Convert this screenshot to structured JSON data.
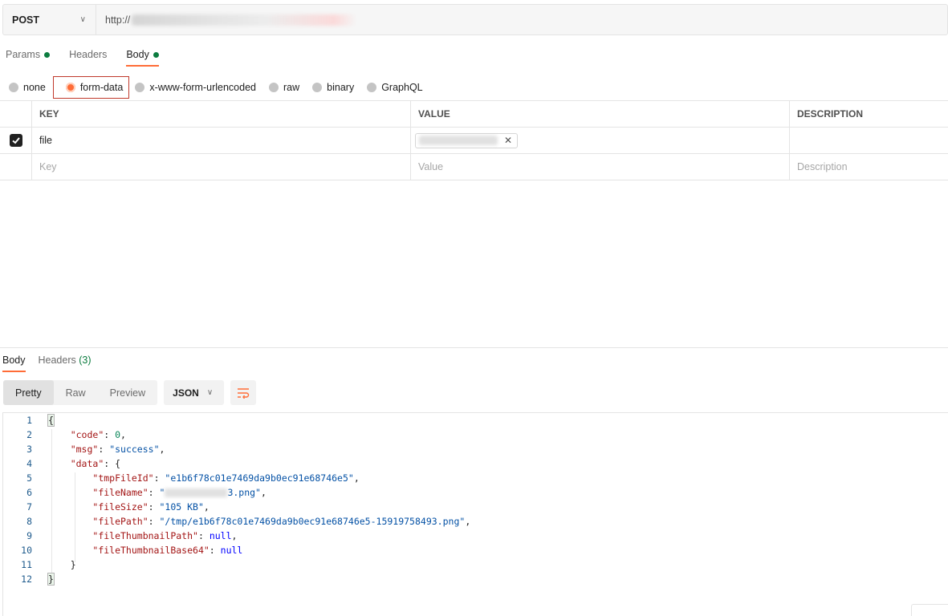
{
  "request": {
    "method": "POST",
    "url_visible": "http://",
    "tabs": [
      {
        "label": "Params",
        "dot": true
      },
      {
        "label": "Headers",
        "dot": false
      },
      {
        "label": "Body",
        "dot": true
      }
    ],
    "body_types": [
      "none",
      "form-data",
      "x-www-form-urlencoded",
      "raw",
      "binary",
      "GraphQL"
    ],
    "selected_body_type": "form-data",
    "table": {
      "headers": [
        "KEY",
        "VALUE",
        "DESCRIPTION"
      ],
      "rows": [
        {
          "key": "file",
          "value_type": "file"
        }
      ],
      "placeholders": {
        "key": "Key",
        "value": "Value",
        "description": "Description"
      }
    }
  },
  "response": {
    "tabs": [
      {
        "label": "Body"
      },
      {
        "label": "Headers",
        "count": "(3)"
      }
    ],
    "views": [
      "Pretty",
      "Raw",
      "Preview"
    ],
    "active_view": "Pretty",
    "format": "JSON",
    "json": {
      "code_key": "\"code\"",
      "code_val": "0",
      "msg_key": "\"msg\"",
      "msg_val": "\"success\"",
      "data_key": "\"data\"",
      "tmpFileId_key": "\"tmpFileId\"",
      "tmpFileId_val": "\"e1b6f78c01e7469da9b0ec91e68746e5\"",
      "fileName_key": "\"fileName\"",
      "fileName_val_start": "\"",
      "fileName_val_end": "3.png\"",
      "fileSize_key": "\"fileSize\"",
      "fileSize_val": "\"105 KB\"",
      "filePath_key": "\"filePath\"",
      "filePath_val": "\"/tmp/e1b6f78c01e7469da9b0ec91e68746e5-15919758493.png\"",
      "fileThumbnailPath_key": "\"fileThumbnailPath\"",
      "fileThumbnailBase64_key": "\"fileThumbnailBase64\"",
      "null_val": "null"
    }
  },
  "colors": {
    "accent": "#ff6c37",
    "status_green": "#0c7c3f",
    "json_key": "#a31515",
    "json_string": "#0451a5",
    "json_number": "#098658",
    "json_keyword": "#0000ff"
  }
}
